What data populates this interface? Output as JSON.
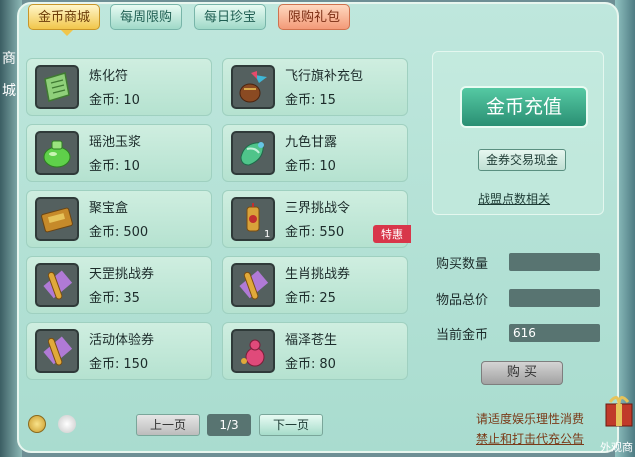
{
  "tabs": [
    {
      "label": "金币商城",
      "state": "active"
    },
    {
      "label": "每周限购",
      "state": "normal"
    },
    {
      "label": "每日珍宝",
      "state": "normal"
    },
    {
      "label": "限购礼包",
      "state": "limited"
    }
  ],
  "price_label": "金币:",
  "items": [
    {
      "name": "炼化符",
      "price": "10",
      "icon": "talisman-icon"
    },
    {
      "name": "飞行旗补充包",
      "price": "15",
      "icon": "flag-pouch-icon"
    },
    {
      "name": "瑶池玉浆",
      "price": "10",
      "icon": "green-jade-jar-icon"
    },
    {
      "name": "九色甘露",
      "price": "10",
      "icon": "nine-color-dew-icon"
    },
    {
      "name": "聚宝盒",
      "price": "500",
      "icon": "treasure-box-icon"
    },
    {
      "name": "三界挑战令",
      "price": "550",
      "icon": "challenge-token-icon",
      "qty": "1",
      "badge": "特惠"
    },
    {
      "name": "天罡挑战券",
      "price": "35",
      "icon": "scroll-icon"
    },
    {
      "name": "生肖挑战券",
      "price": "25",
      "icon": "scroll-icon"
    },
    {
      "name": "活动体验券",
      "price": "150",
      "icon": "scroll-icon"
    },
    {
      "name": "福泽苍生",
      "price": "80",
      "icon": "red-gourd-icon"
    }
  ],
  "sidebar": {
    "recharge": "金币充值",
    "trade": "金券交易现金",
    "alliance": "战盟点数相关"
  },
  "form": {
    "qty_label": "购买数量",
    "qty_value": "",
    "total_label": "物品总价",
    "total_value": "",
    "gold_label": "当前金币",
    "gold_value": "616",
    "buy": "购 买"
  },
  "pager": {
    "prev": "上一页",
    "pages": "1/3",
    "next": "下一页"
  },
  "notice": [
    "请适度娱乐理性消费",
    "禁止和打击代充公告"
  ],
  "edge": {
    "left": [
      "商",
      "城"
    ],
    "corner": "外观商"
  },
  "colors": {
    "accent": "#2a8f73",
    "badge": "#d8364a",
    "panel": "#bfe7dd"
  }
}
